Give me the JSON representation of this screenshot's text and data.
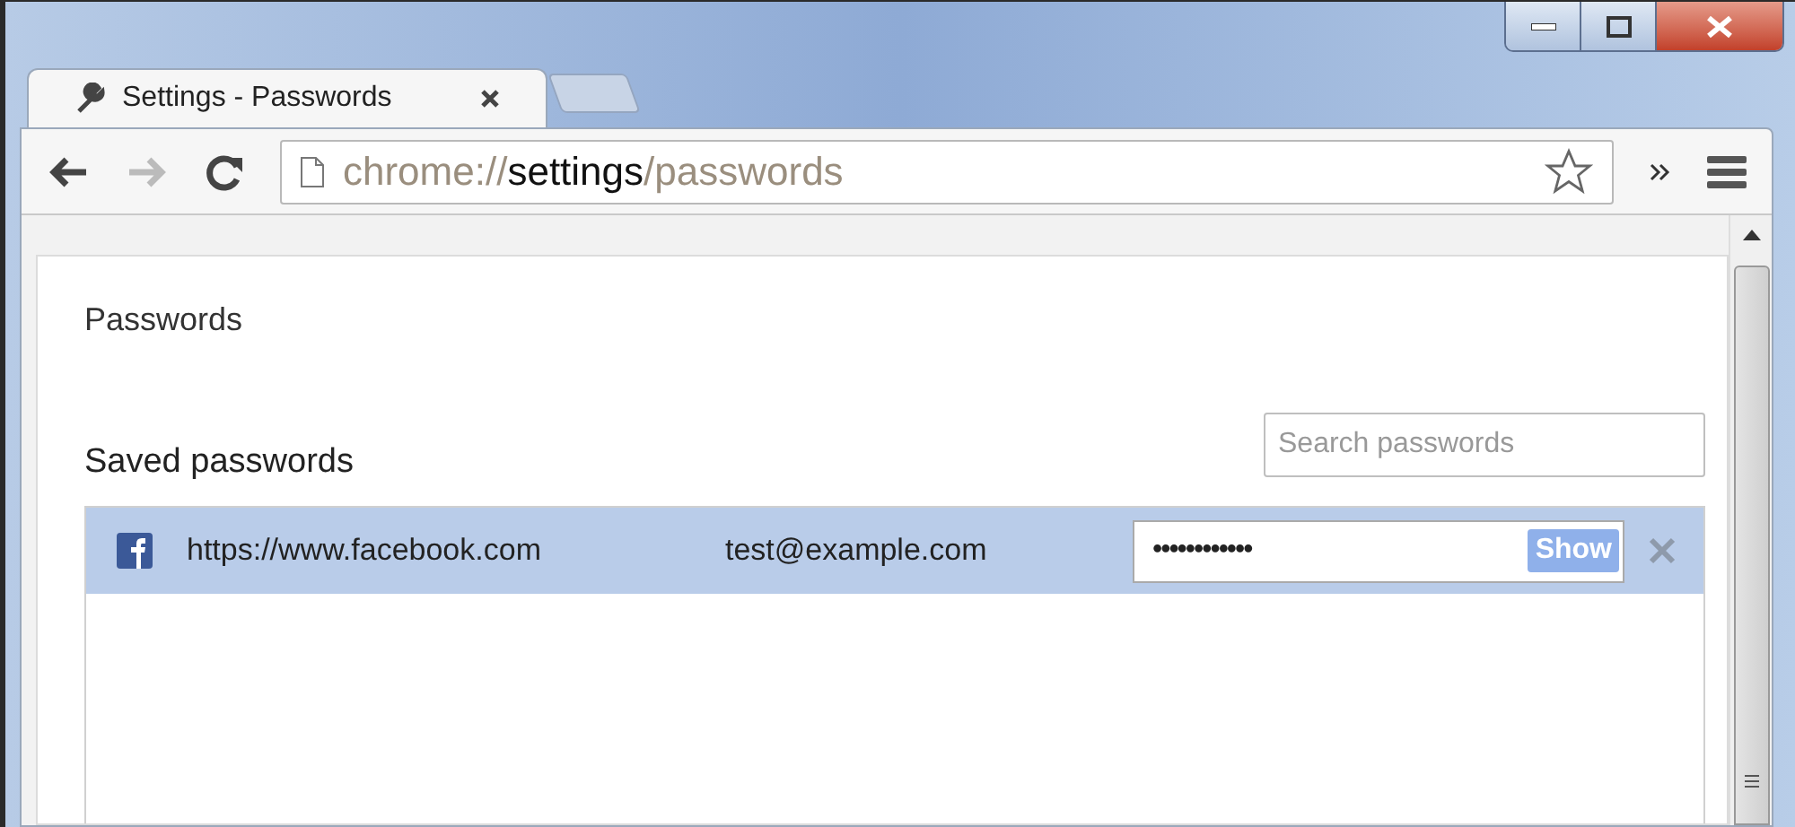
{
  "tabs": [
    {
      "title": "Settings - Passwords",
      "selected": true
    }
  ],
  "address": {
    "scheme": "chrome://",
    "host": "settings",
    "path": "/passwords"
  },
  "page": {
    "title": "Passwords",
    "section": "Saved passwords",
    "search": {
      "placeholder": "Search passwords"
    },
    "rows": [
      {
        "site": "https://www.facebook.com",
        "user": "test@example.com",
        "password": "••••••••••••",
        "button": "Show",
        "selected": true
      }
    ]
  }
}
